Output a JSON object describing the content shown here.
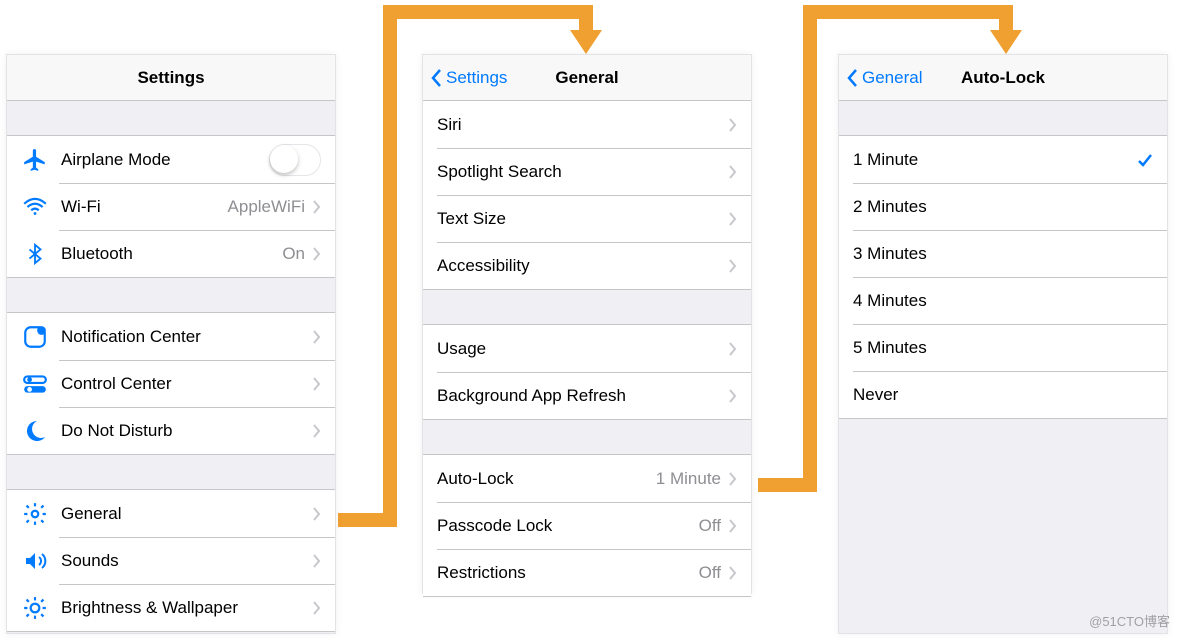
{
  "watermark": "@51CTO博客",
  "panel1": {
    "title": "Settings",
    "groupA": [
      {
        "label": "Airplane Mode",
        "icon": "airplane",
        "toggle": true
      },
      {
        "label": "Wi-Fi",
        "icon": "wifi",
        "value": "AppleWiFi",
        "chevron": true
      },
      {
        "label": "Bluetooth",
        "icon": "bluetooth",
        "value": "On",
        "chevron": true
      }
    ],
    "groupB": [
      {
        "label": "Notification Center",
        "icon": "notif",
        "chevron": true
      },
      {
        "label": "Control Center",
        "icon": "control",
        "chevron": true
      },
      {
        "label": "Do Not Disturb",
        "icon": "moon",
        "chevron": true
      }
    ],
    "groupC": [
      {
        "label": "General",
        "icon": "gear",
        "chevron": true
      },
      {
        "label": "Sounds",
        "icon": "sound",
        "chevron": true
      },
      {
        "label": "Brightness & Wallpaper",
        "icon": "bright",
        "chevron": true
      }
    ]
  },
  "panel2": {
    "back": "Settings",
    "title": "General",
    "groupA": [
      {
        "label": "Siri",
        "chevron": true
      },
      {
        "label": "Spotlight Search",
        "chevron": true
      },
      {
        "label": "Text Size",
        "chevron": true
      },
      {
        "label": "Accessibility",
        "chevron": true
      }
    ],
    "groupB": [
      {
        "label": "Usage",
        "chevron": true
      },
      {
        "label": "Background App Refresh",
        "chevron": true
      }
    ],
    "groupC": [
      {
        "label": "Auto-Lock",
        "value": "1 Minute",
        "chevron": true
      },
      {
        "label": "Passcode Lock",
        "value": "Off",
        "chevron": true
      },
      {
        "label": "Restrictions",
        "value": "Off",
        "chevron": true
      }
    ]
  },
  "panel3": {
    "back": "General",
    "title": "Auto-Lock",
    "options": [
      {
        "label": "1 Minute",
        "selected": true
      },
      {
        "label": "2 Minutes"
      },
      {
        "label": "3 Minutes"
      },
      {
        "label": "4 Minutes"
      },
      {
        "label": "5 Minutes"
      },
      {
        "label": "Never"
      }
    ]
  }
}
